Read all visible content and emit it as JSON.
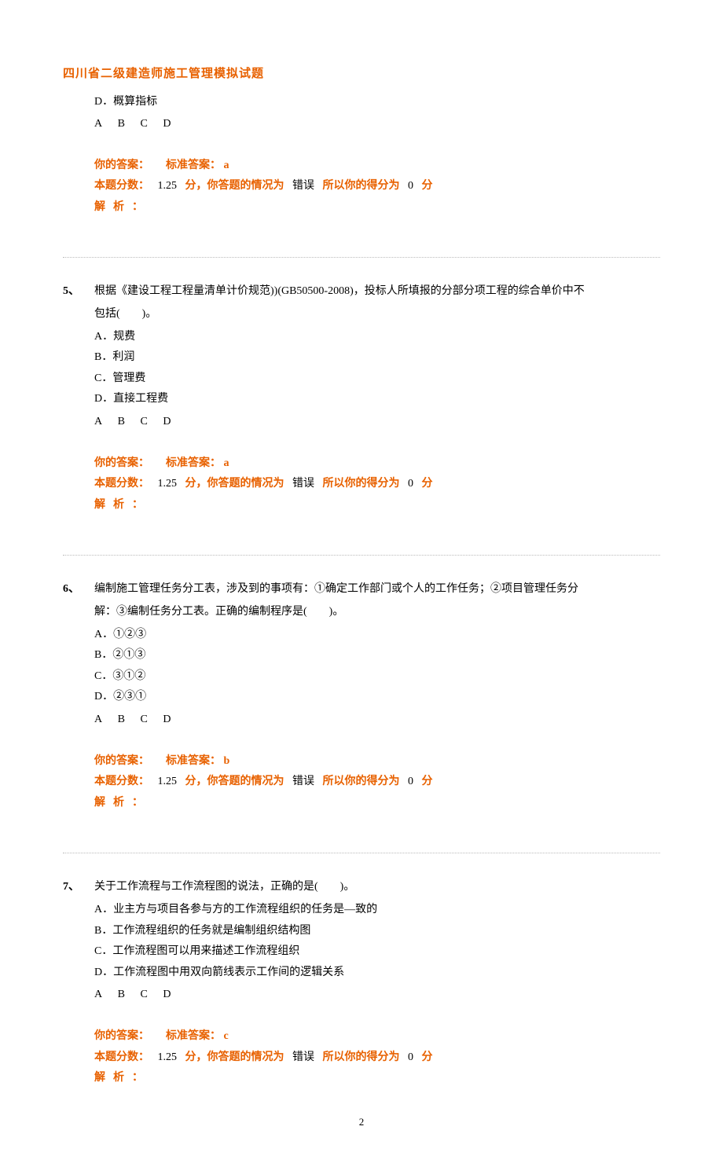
{
  "page_title": "四川省二级建造师施工管理模拟试题",
  "page_number": "2",
  "partial_question": {
    "options": [
      "D．概算指标"
    ],
    "choices": [
      "A",
      "B",
      "C",
      "D"
    ],
    "your_answer_label": "你的答案：",
    "standard_answer_label": "标准答案：",
    "standard_answer": "a",
    "score_prefix": "本题分数：",
    "score_value": "1.25",
    "score_unit": "分，你答题的情况为",
    "status": "错误",
    "score_suffix": "所以你的得分为",
    "got_score": "0",
    "got_unit": "分",
    "analysis_label": "解析："
  },
  "questions": [
    {
      "number": "5、",
      "text_line1": "根据《建设工程工程量清单计价规范))(GB50500-2008)，投标人所填报的分部分项工程的综合单价中不",
      "text_line2": "包括(　　)。",
      "options": [
        "A．规费",
        "B．利润",
        "C．管理费",
        "D．直接工程费"
      ],
      "choices": [
        "A",
        "B",
        "C",
        "D"
      ],
      "your_answer_label": "你的答案：",
      "standard_answer_label": "标准答案：",
      "standard_answer": "a",
      "score_prefix": "本题分数：",
      "score_value": "1.25",
      "score_unit": "分，你答题的情况为",
      "status": "错误",
      "score_suffix": "所以你的得分为",
      "got_score": "0",
      "got_unit": "分",
      "analysis_label": "解析："
    },
    {
      "number": "6、",
      "text_line1": "编制施工管理任务分工表，涉及到的事项有：①确定工作部门或个人的工作任务；②项目管理任务分",
      "text_line2": "解：③编制任务分工表。正确的编制程序是(　　)。",
      "options": [
        "A．①②③",
        "B．②①③",
        "C．③①②",
        "D．②③①"
      ],
      "choices": [
        "A",
        "B",
        "C",
        "D"
      ],
      "your_answer_label": "你的答案：",
      "standard_answer_label": "标准答案：",
      "standard_answer": "b",
      "score_prefix": "本题分数：",
      "score_value": "1.25",
      "score_unit": "分，你答题的情况为",
      "status": "错误",
      "score_suffix": "所以你的得分为",
      "got_score": "0",
      "got_unit": "分",
      "analysis_label": "解析："
    },
    {
      "number": "7、",
      "text_line1": "关于工作流程与工作流程图的说法，正确的是(　　)。",
      "text_line2": "",
      "options": [
        "A．业主方与项目各参与方的工作流程组织的任务是—致的",
        "B．工作流程组织的任务就是编制组织结构图",
        "C．工作流程图可以用来描述工作流程组织",
        "D．工作流程图中用双向箭线表示工作间的逻辑关系"
      ],
      "choices": [
        "A",
        "B",
        "C",
        "D"
      ],
      "your_answer_label": "你的答案：",
      "standard_answer_label": "标准答案：",
      "standard_answer": "c",
      "score_prefix": "本题分数：",
      "score_value": "1.25",
      "score_unit": "分，你答题的情况为",
      "status": "错误",
      "score_suffix": "所以你的得分为",
      "got_score": "0",
      "got_unit": "分",
      "analysis_label": "解析："
    }
  ]
}
